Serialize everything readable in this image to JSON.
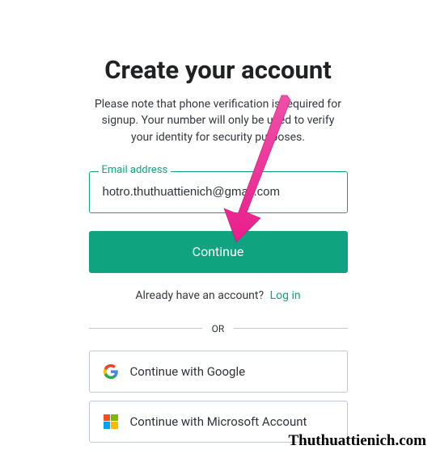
{
  "header": {
    "title": "Create your account",
    "subtitle": "Please note that phone verification is required for signup. Your number will only be used to verify your identity for security purposes."
  },
  "form": {
    "email_label": "Email address",
    "email_value": "hotro.thuthuattienich@gmail.com",
    "continue_label": "Continue"
  },
  "login": {
    "prompt": "Already have an account?",
    "link_label": "Log in"
  },
  "divider": {
    "label": "OR"
  },
  "social": {
    "google_label": "Continue with Google",
    "microsoft_label": "Continue with Microsoft Account"
  },
  "watermark": {
    "text": "Thuthuattienich.com"
  },
  "colors": {
    "accent": "#10a37f",
    "arrow": "#e91e8c"
  }
}
